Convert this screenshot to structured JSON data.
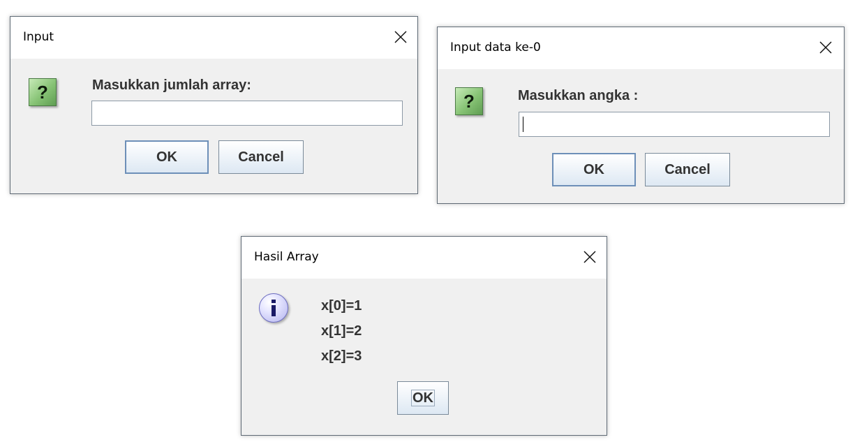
{
  "dialog_input": {
    "title": "Input",
    "prompt": "Masukkan jumlah array:",
    "input_value": "",
    "ok_label": "OK",
    "cancel_label": "Cancel",
    "icon": "question-icon"
  },
  "dialog_input_data": {
    "title": "Input data ke-0",
    "prompt": "Masukkan angka :",
    "input_value": "",
    "ok_label": "OK",
    "cancel_label": "Cancel",
    "icon": "question-icon"
  },
  "dialog_result": {
    "title": "Hasil Array",
    "lines": [
      "x[0]=1",
      "x[1]=2",
      "x[2]=3"
    ],
    "ok_label": "OK",
    "icon": "information-icon"
  },
  "icons": {
    "question_glyph": "?",
    "close_glyph": "close-icon"
  },
  "colors": {
    "dialog_bg": "#f0f0f0",
    "titlebar_bg": "#ffffff",
    "question_icon": "#86c274",
    "info_icon": "#b3b3ee",
    "text": "#333333"
  }
}
